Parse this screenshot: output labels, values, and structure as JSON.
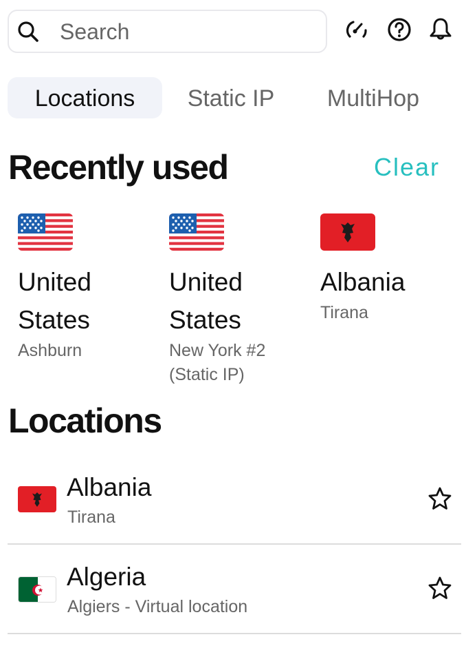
{
  "search": {
    "placeholder": "Search",
    "icon": "search-icon"
  },
  "header_icons": [
    {
      "name": "speed-test-icon"
    },
    {
      "name": "help-icon"
    },
    {
      "name": "notifications-bell-icon"
    }
  ],
  "tabs": [
    {
      "label": "Locations",
      "active": true
    },
    {
      "label": "Static IP",
      "active": false
    },
    {
      "label": "MultiHop",
      "active": false
    }
  ],
  "recently_used": {
    "title": "Recently used",
    "clear_label": "Clear",
    "accent_color": "#27bfbf",
    "items": [
      {
        "country_line1": "United",
        "country_line2": "States",
        "city_line1": "Ashburn",
        "city_line2": "",
        "flag": "us-flag"
      },
      {
        "country_line1": "United",
        "country_line2": "States",
        "city_line1": "New York #2",
        "city_line2": "(Static IP)",
        "flag": "us-flag"
      },
      {
        "country_line1": "Albania",
        "country_line2": "",
        "city_line1": "Tirana",
        "city_line2": "",
        "flag": "albania-flag"
      }
    ]
  },
  "locations": {
    "title": "Locations",
    "items": [
      {
        "country": "Albania",
        "city": "Tirana",
        "flag": "albania-flag",
        "favorite": false
      },
      {
        "country": "Algeria",
        "city": "Algiers - Virtual location",
        "flag": "algeria-flag",
        "favorite": false
      }
    ]
  }
}
